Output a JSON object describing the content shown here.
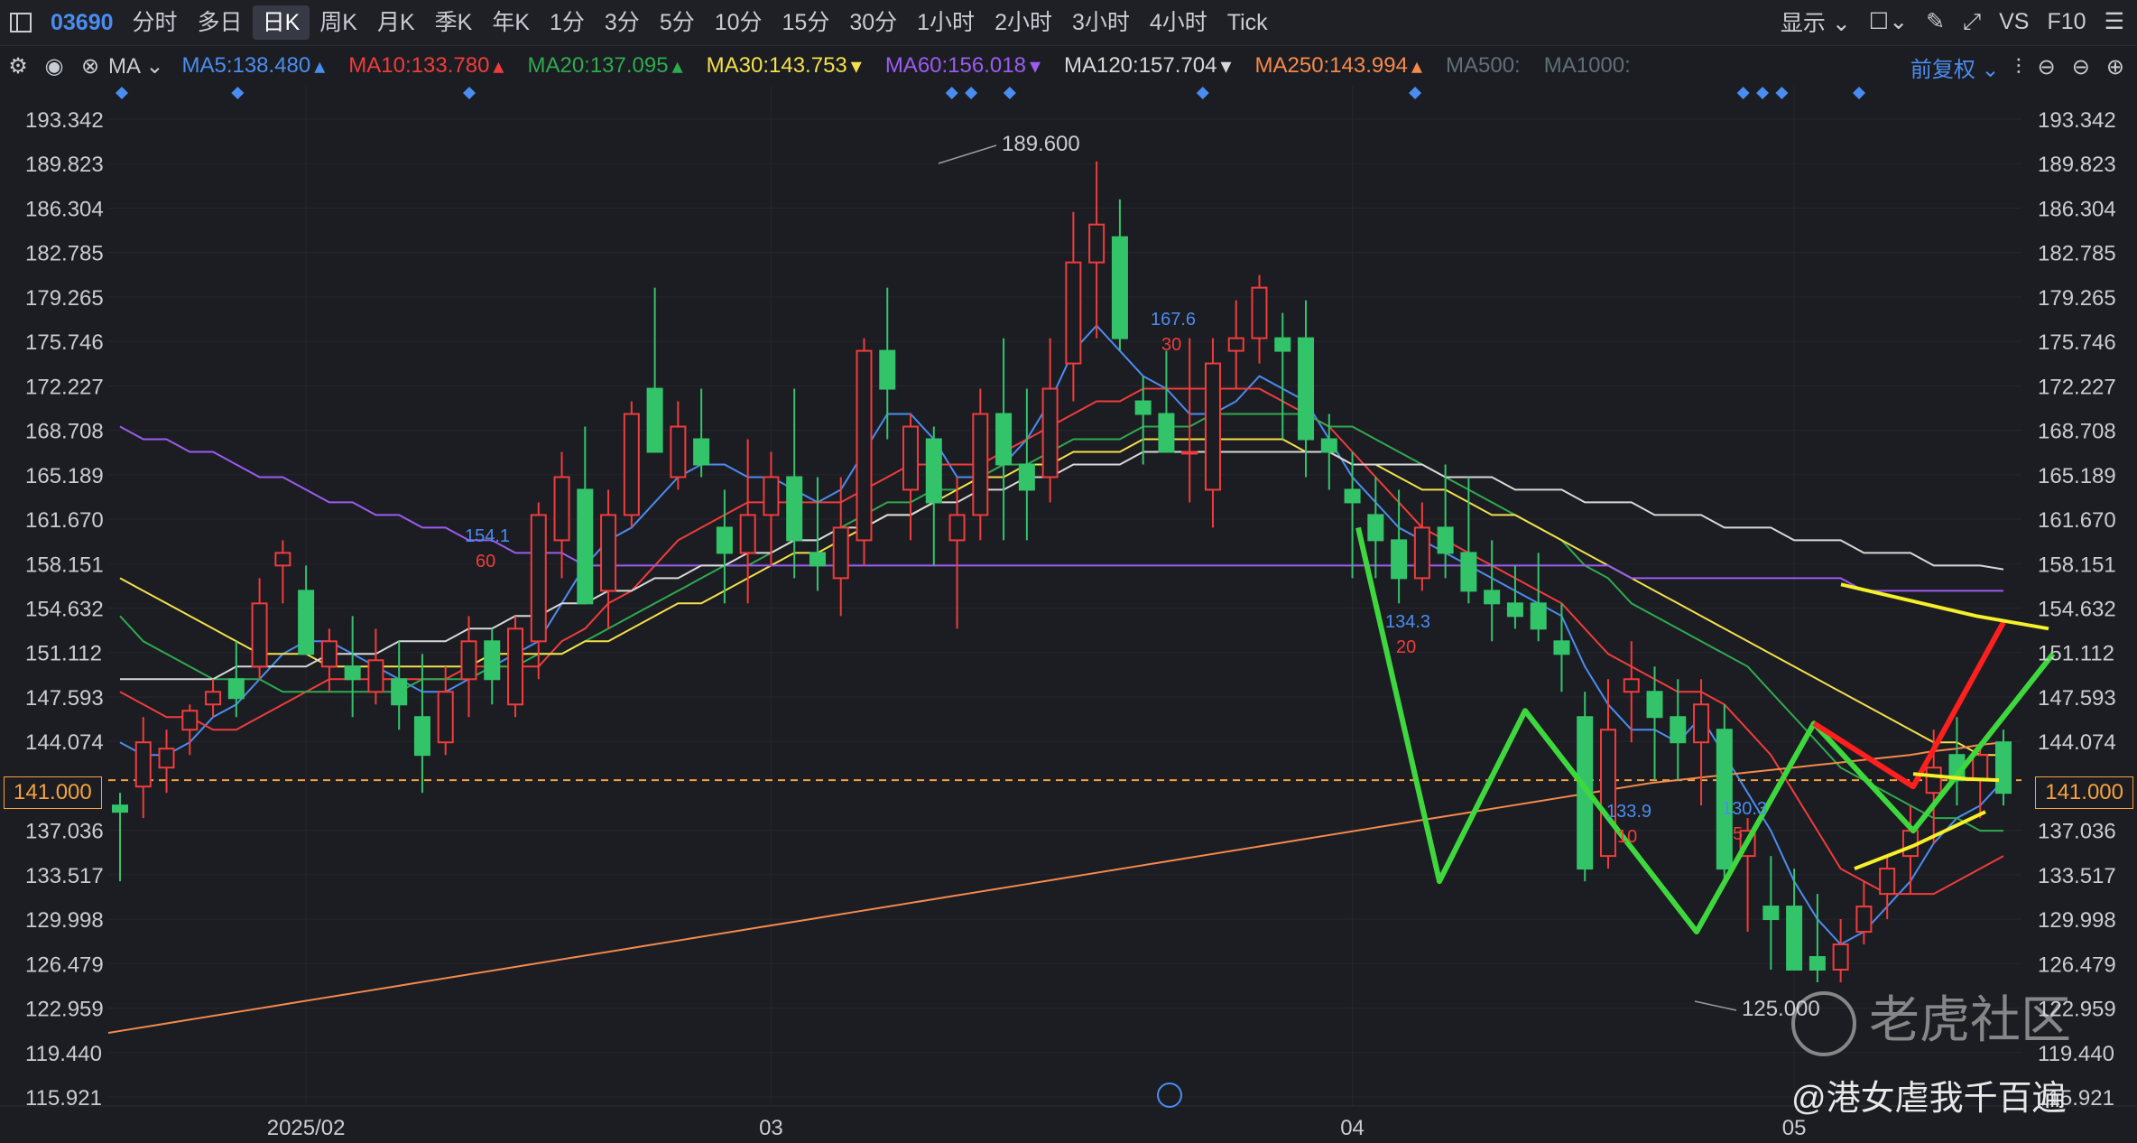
{
  "toolbar": {
    "symbol": "03690",
    "periods": [
      "分时",
      "多日",
      "日K",
      "周K",
      "月K",
      "季K",
      "年K",
      "1分",
      "3分",
      "5分",
      "10分",
      "15分",
      "30分",
      "1小时",
      "2小时",
      "3小时",
      "4小时",
      "Tick"
    ],
    "active_period": "日K",
    "display_label": "显示",
    "vs_label": "VS",
    "f10_label": "F10"
  },
  "ma_bar": {
    "type_label": "MA",
    "items": [
      {
        "label": "MA5:138.480",
        "color": "#4a8df0",
        "arrow": "▴"
      },
      {
        "label": "MA10:133.780",
        "color": "#f03c3c",
        "arrow": "▴"
      },
      {
        "label": "MA20:137.095",
        "color": "#2faa4f",
        "arrow": "▴"
      },
      {
        "label": "MA30:143.753",
        "color": "#f5e04a",
        "arrow": "▾"
      },
      {
        "label": "MA60:156.018",
        "color": "#9b5cf0",
        "arrow": "▾"
      },
      {
        "label": "MA120:157.704",
        "color": "#d8d8d8",
        "arrow": "▾"
      },
      {
        "label": "MA250:143.994",
        "color": "#f58a4c",
        "arrow": "▴"
      },
      {
        "label": "MA500:",
        "color": "#5f6f7a",
        "arrow": ""
      },
      {
        "label": "MA1000:",
        "color": "#5f6f7a",
        "arrow": ""
      }
    ],
    "adjust_label": "前复权"
  },
  "current_price": "141.000",
  "watermark": {
    "brand": "老虎社区",
    "author": "@港女虐我千百遍"
  },
  "chart_data": {
    "type": "candlestick",
    "ylim": [
      115.921,
      195.0
    ],
    "y_ticks": [
      "193.342",
      "189.823",
      "186.304",
      "182.785",
      "179.265",
      "175.746",
      "172.227",
      "168.708",
      "165.189",
      "161.670",
      "158.151",
      "154.632",
      "151.112",
      "147.593",
      "144.074",
      "141.000",
      "137.036",
      "133.517",
      "129.998",
      "126.479",
      "122.959",
      "119.440",
      "115.921"
    ],
    "x_labels": [
      {
        "label": "2025/02",
        "index": 8
      },
      {
        "label": "03",
        "index": 28
      },
      {
        "label": "04",
        "index": 53
      },
      {
        "label": "05",
        "index": 72
      }
    ],
    "candles_ohlc": [
      [
        139,
        140,
        133,
        138.5
      ],
      [
        140.5,
        146,
        138,
        144
      ],
      [
        142,
        145,
        140,
        143.5
      ],
      [
        145,
        147,
        143,
        146.5
      ],
      [
        147,
        149,
        146,
        148
      ],
      [
        149,
        152,
        146,
        147.5
      ],
      [
        150,
        157,
        149,
        155
      ],
      [
        158,
        160,
        155,
        159
      ],
      [
        156,
        158,
        152,
        151
      ],
      [
        150,
        153,
        148,
        152
      ],
      [
        150,
        154,
        146,
        149
      ],
      [
        148,
        153,
        147,
        150.5
      ],
      [
        149,
        152,
        145,
        147
      ],
      [
        146,
        151,
        140,
        143
      ],
      [
        144,
        150,
        143,
        148
      ],
      [
        149,
        154,
        146,
        152
      ],
      [
        152,
        153,
        147,
        149
      ],
      [
        147,
        154,
        146,
        153
      ],
      [
        152,
        163,
        149,
        162
      ],
      [
        160,
        167,
        157,
        165
      ],
      [
        164,
        169,
        155,
        155
      ],
      [
        156,
        164,
        153,
        162
      ],
      [
        162,
        171,
        161,
        170
      ],
      [
        172,
        180,
        170,
        167
      ],
      [
        165,
        171,
        164,
        169
      ],
      [
        168,
        172,
        165,
        166
      ],
      [
        161,
        164,
        155,
        159
      ],
      [
        159,
        168,
        155,
        162
      ],
      [
        162,
        167,
        158,
        165
      ],
      [
        165,
        172,
        157,
        160
      ],
      [
        159,
        165,
        156,
        158
      ],
      [
        157,
        165,
        154,
        161
      ],
      [
        160,
        176,
        158,
        175
      ],
      [
        175,
        180,
        168,
        172
      ],
      [
        164,
        170,
        160,
        169
      ],
      [
        168,
        169,
        158,
        163
      ],
      [
        160,
        165,
        153,
        162
      ],
      [
        162,
        172,
        160,
        170
      ],
      [
        170,
        176,
        160,
        166
      ],
      [
        166,
        172,
        160,
        164
      ],
      [
        165,
        176,
        163,
        172
      ],
      [
        174,
        186,
        171,
        182
      ],
      [
        182,
        190,
        176,
        185
      ],
      [
        184,
        187,
        175,
        176
      ],
      [
        171,
        173,
        166,
        170
      ],
      [
        170,
        175,
        167,
        167
      ],
      [
        167,
        176,
        163,
        167
      ],
      [
        164,
        176,
        161,
        174
      ],
      [
        175,
        179,
        172,
        176
      ],
      [
        176,
        181,
        174,
        180
      ],
      [
        176,
        178,
        168,
        175
      ],
      [
        176,
        179,
        165,
        168
      ],
      [
        168,
        170,
        164,
        167
      ],
      [
        164,
        167,
        157,
        163
      ],
      [
        162,
        165,
        157,
        160
      ],
      [
        160,
        164,
        155,
        157
      ],
      [
        157,
        163,
        156,
        161
      ],
      [
        161,
        166,
        157,
        159
      ],
      [
        159,
        165,
        155,
        156
      ],
      [
        156,
        160,
        152,
        155
      ],
      [
        155,
        158,
        153,
        154
      ],
      [
        155,
        159,
        152,
        153
      ],
      [
        152,
        155,
        148,
        151
      ],
      [
        146,
        148,
        133,
        134
      ],
      [
        135,
        149,
        134,
        145
      ],
      [
        148,
        152,
        144,
        149
      ],
      [
        148,
        150,
        141,
        146
      ],
      [
        146,
        149,
        141,
        144
      ],
      [
        144,
        149,
        139,
        147
      ],
      [
        145,
        147,
        133,
        134
      ],
      [
        135,
        138,
        129,
        137
      ],
      [
        131,
        135,
        126,
        130
      ],
      [
        131,
        134,
        126,
        126
      ],
      [
        127,
        132,
        125,
        126
      ],
      [
        126,
        130,
        125,
        128
      ],
      [
        129,
        133,
        128,
        131
      ],
      [
        132,
        135,
        130,
        134
      ],
      [
        135,
        139,
        132,
        137
      ],
      [
        140,
        145,
        136,
        142
      ],
      [
        143,
        146,
        139,
        141
      ],
      [
        141,
        144,
        138,
        143
      ],
      [
        144,
        145,
        139,
        140
      ]
    ],
    "moving_averages": {
      "MA5": [
        144,
        143,
        143,
        144,
        146,
        147,
        149,
        151,
        152,
        152,
        151,
        150,
        149,
        148,
        148,
        149,
        150,
        151,
        152,
        155,
        158,
        160,
        161,
        163,
        165,
        166,
        166,
        165,
        165,
        164,
        163,
        164,
        167,
        170,
        170,
        168,
        165,
        165,
        166,
        168,
        171,
        175,
        177,
        175,
        173,
        172,
        170,
        170,
        171,
        173,
        172,
        171,
        168,
        165,
        163,
        161,
        160,
        159,
        158,
        157,
        156,
        155,
        154,
        150,
        147,
        145,
        145,
        144,
        146,
        143,
        140,
        137,
        133,
        130,
        128,
        129,
        131,
        133,
        136,
        138,
        139,
        141
      ],
      "MA10": [
        148,
        147,
        146,
        146,
        145,
        145,
        146,
        147,
        148,
        149,
        149,
        149,
        149,
        149,
        149,
        150,
        150,
        150,
        150,
        152,
        153,
        155,
        156,
        158,
        160,
        161,
        162,
        163,
        163,
        163,
        163,
        163,
        164,
        165,
        166,
        166,
        166,
        166,
        167,
        168,
        169,
        170,
        171,
        171,
        172,
        172,
        172,
        172,
        172,
        172,
        171,
        170,
        169,
        167,
        165,
        163,
        161,
        160,
        159,
        158,
        157,
        156,
        155,
        153,
        151,
        150,
        149,
        148,
        148,
        147,
        145,
        143,
        140,
        137,
        134,
        133,
        132,
        132,
        132,
        133,
        134,
        135
      ],
      "MA20": [
        154,
        152,
        151,
        150,
        149,
        149,
        149,
        148,
        148,
        148,
        148,
        148,
        148,
        149,
        149,
        149,
        150,
        150,
        151,
        151,
        152,
        153,
        154,
        155,
        156,
        157,
        158,
        158,
        159,
        160,
        160,
        161,
        162,
        163,
        163,
        164,
        164,
        165,
        166,
        166,
        167,
        168,
        168,
        168,
        169,
        169,
        169,
        170,
        170,
        170,
        170,
        170,
        169,
        169,
        168,
        167,
        166,
        165,
        164,
        163,
        162,
        161,
        160,
        158,
        157,
        155,
        154,
        153,
        152,
        151,
        150,
        148,
        146,
        144,
        142,
        141,
        140,
        139,
        138,
        138,
        137,
        137
      ],
      "MA30": [
        157,
        156,
        155,
        154,
        153,
        152,
        151,
        151,
        151,
        150,
        150,
        150,
        150,
        150,
        150,
        150,
        151,
        151,
        151,
        151,
        152,
        152,
        153,
        154,
        155,
        155,
        156,
        157,
        158,
        159,
        159,
        160,
        161,
        162,
        162,
        163,
        164,
        165,
        165,
        166,
        166,
        167,
        167,
        167,
        168,
        168,
        168,
        168,
        168,
        168,
        168,
        167,
        167,
        166,
        166,
        165,
        164,
        164,
        163,
        162,
        162,
        161,
        160,
        159,
        158,
        157,
        156,
        155,
        154,
        153,
        152,
        151,
        150,
        149,
        148,
        147,
        146,
        145,
        144,
        144,
        143,
        143
      ],
      "MA60": [
        169,
        168,
        168,
        167,
        167,
        166,
        165,
        165,
        164,
        163,
        163,
        162,
        162,
        161,
        161,
        160,
        160,
        159,
        159,
        159,
        158,
        158,
        158,
        158,
        158,
        158,
        158,
        158,
        158,
        158,
        158,
        158,
        158,
        158,
        158,
        158,
        158,
        158,
        158,
        158,
        158,
        158,
        158,
        158,
        158,
        158,
        158,
        158,
        158,
        158,
        158,
        158,
        158,
        158,
        158,
        158,
        158,
        158,
        158,
        158,
        158,
        158,
        158,
        158,
        158,
        157,
        157,
        157,
        157,
        157,
        157,
        157,
        157,
        157,
        157,
        156,
        156,
        156,
        156,
        156,
        156,
        156
      ],
      "MA120": [
        149,
        149,
        149,
        149,
        149,
        150,
        150,
        150,
        150,
        151,
        151,
        151,
        152,
        152,
        152,
        153,
        153,
        154,
        154,
        155,
        155,
        156,
        156,
        157,
        157,
        158,
        158,
        159,
        159,
        160,
        160,
        161,
        161,
        162,
        162,
        163,
        163,
        164,
        164,
        165,
        165,
        166,
        166,
        166,
        167,
        167,
        167,
        167,
        167,
        167,
        167,
        167,
        167,
        166,
        166,
        166,
        166,
        165,
        165,
        165,
        164,
        164,
        164,
        163,
        163,
        163,
        162,
        162,
        162,
        161,
        161,
        161,
        160,
        160,
        160,
        159,
        159,
        159,
        158,
        158,
        158,
        157.7
      ],
      "MA250": [
        121,
        121.3,
        121.6,
        121.9,
        122.2,
        122.5,
        122.8,
        123.1,
        123.4,
        123.7,
        124,
        124.3,
        124.6,
        124.9,
        125.2,
        125.5,
        125.8,
        126.1,
        126.4,
        126.7,
        127,
        127.3,
        127.6,
        127.9,
        128.2,
        128.5,
        128.8,
        129.1,
        129.4,
        129.7,
        130,
        130.3,
        130.6,
        130.9,
        131.2,
        131.5,
        131.8,
        132.1,
        132.4,
        132.7,
        133,
        133.3,
        133.6,
        133.9,
        134.2,
        134.5,
        134.8,
        135.1,
        135.4,
        135.7,
        136,
        136.3,
        136.6,
        136.9,
        137.2,
        137.5,
        137.8,
        138.1,
        138.4,
        138.7,
        139,
        139.3,
        139.6,
        139.9,
        140.2,
        140.5,
        140.8,
        141,
        141.2,
        141.4,
        141.6,
        141.8,
        142,
        142.2,
        142.4,
        142.6,
        142.8,
        143,
        143.3,
        143.5,
        143.8,
        144
      ]
    },
    "annotations": [
      {
        "text": "189.600",
        "kind": "high"
      },
      {
        "text": "125.000",
        "kind": "low"
      },
      {
        "text": "154.1",
        "sub": "60"
      },
      {
        "text": "167.6",
        "sub": "30"
      },
      {
        "text": "134.3",
        "sub": "20"
      },
      {
        "text": "133.9",
        "sub": "10"
      },
      {
        "text": "130.3",
        "sub": "5"
      }
    ],
    "drawn_paths": {
      "green": [
        [
          161,
          145
        ],
        [
          133,
          133.5
        ],
        [
          146.5,
          145.5
        ],
        [
          129,
          124.5
        ],
        [
          145.5,
          145.5
        ],
        [
          137,
          135.5
        ],
        [
          151,
          151
        ]
      ],
      "red": [
        [
          145.5,
          145.5
        ],
        [
          140.5,
          140.5
        ],
        [
          153.5,
          153.5
        ]
      ],
      "yellow_upper": [
        156.5,
        154,
        153
      ],
      "yellow_lower": [
        134,
        135.8,
        138.5
      ]
    }
  }
}
